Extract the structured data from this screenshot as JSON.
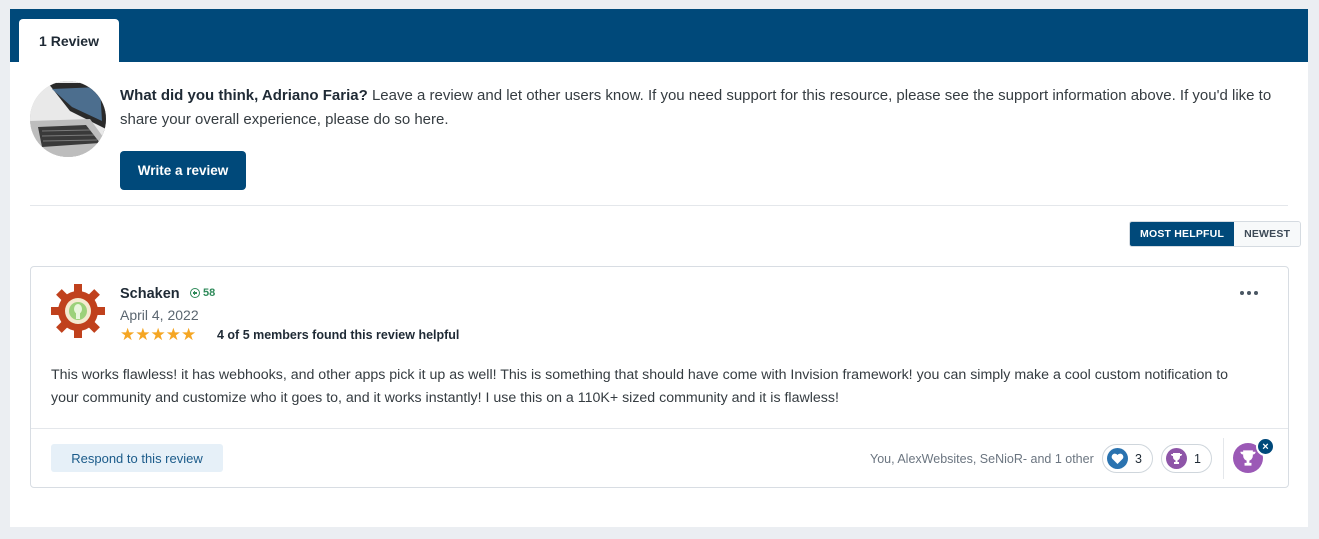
{
  "tabs": [
    {
      "label": "1 Review"
    }
  ],
  "prompt": {
    "lead": "What did you think, Adriano Faria?",
    "text": " Leave a review and let other users know. If you need support for this resource, please see the support information above. If you'd like to share your overall experience, please do so here.",
    "write_button": "Write a review"
  },
  "sort": {
    "options": [
      {
        "label": "MOST HELPFUL",
        "active": true
      },
      {
        "label": "NEWEST",
        "active": false
      }
    ]
  },
  "review": {
    "author": "Schaken",
    "reputation": "58",
    "date": "April 4, 2022",
    "rating": 5,
    "rating_max": 5,
    "stars": "★★★★★",
    "helpful": "4 of 5 members found this review helpful",
    "body": "This works flawless! it has webhooks, and other apps pick it up as well! This is something that should have come with Invision framework! you can simply make a cool custom notification to your community and customize who it goes to, and it works instantly! I use this on a 110K+ sized community and it is flawless!",
    "respond_button": "Respond to this review",
    "reactions_summary": "You, AlexWebsites, SeNioR- and 1 other",
    "reactions": [
      {
        "icon": "heart-icon",
        "count": "3",
        "color": "#2a73b0"
      },
      {
        "icon": "trophy-icon",
        "count": "1",
        "color": "#8e55a8"
      }
    ],
    "react_close": "×"
  },
  "colors": {
    "brand": "#00497a",
    "star": "#f5a623",
    "reputation": "#2f8a5a"
  }
}
